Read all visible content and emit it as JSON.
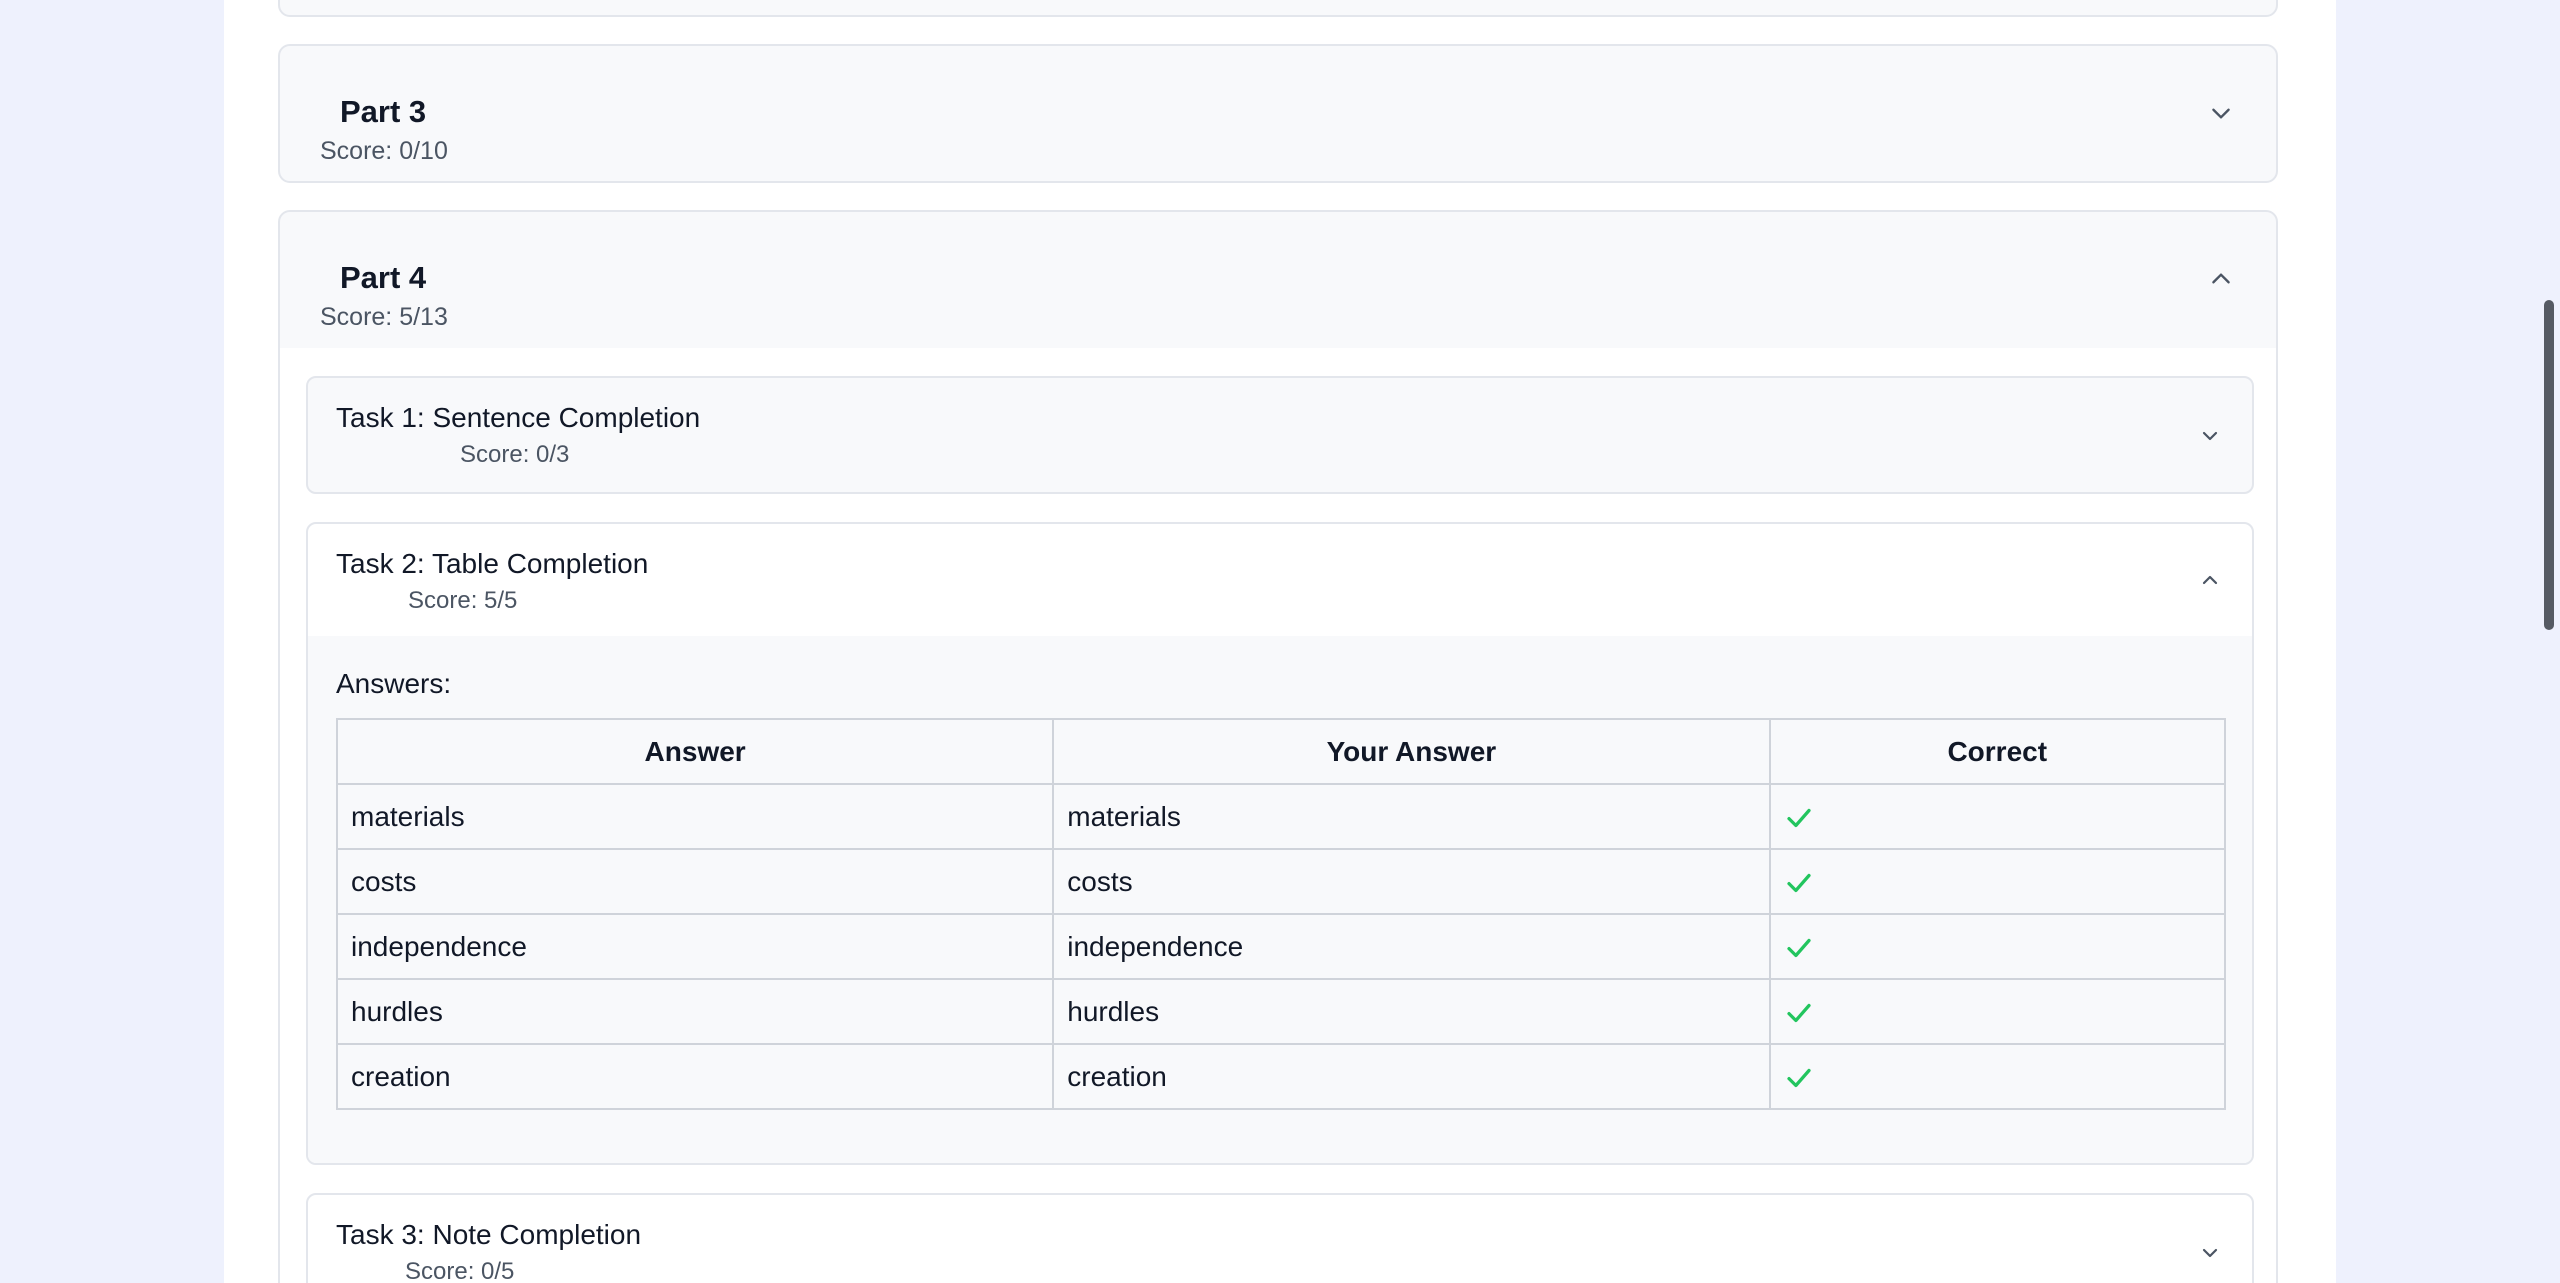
{
  "parts": [
    {
      "title": "Part 3",
      "score": "Score: 0/10",
      "expanded": false
    },
    {
      "title": "Part 4",
      "score": "Score: 5/13",
      "expanded": true
    }
  ],
  "part4_tasks": [
    {
      "title": "Task 1: Sentence Completion",
      "score": "Score: 0/3",
      "expanded": false
    },
    {
      "title": "Task 2: Table Completion",
      "score": "Score: 5/5",
      "expanded": true
    },
    {
      "title": "Task 3: Note Completion",
      "score": "Score: 0/5",
      "expanded": false
    }
  ],
  "answers_section": {
    "label": "Answers:",
    "columns": [
      "Answer",
      "Your Answer",
      "Correct"
    ],
    "rows": [
      {
        "answer": "materials",
        "your_answer": "materials",
        "correct": true
      },
      {
        "answer": "costs",
        "your_answer": "costs",
        "correct": true
      },
      {
        "answer": "independence",
        "your_answer": "independence",
        "correct": true
      },
      {
        "answer": "hurdles",
        "your_answer": "hurdles",
        "correct": true
      },
      {
        "answer": "creation",
        "your_answer": "creation",
        "correct": true
      }
    ]
  },
  "icons": {
    "expand": "chevron-down-icon",
    "collapse": "chevron-up-icon",
    "correct": "check-icon"
  },
  "colors": {
    "check": "#22c55e",
    "page_background": "#eef1fd"
  }
}
